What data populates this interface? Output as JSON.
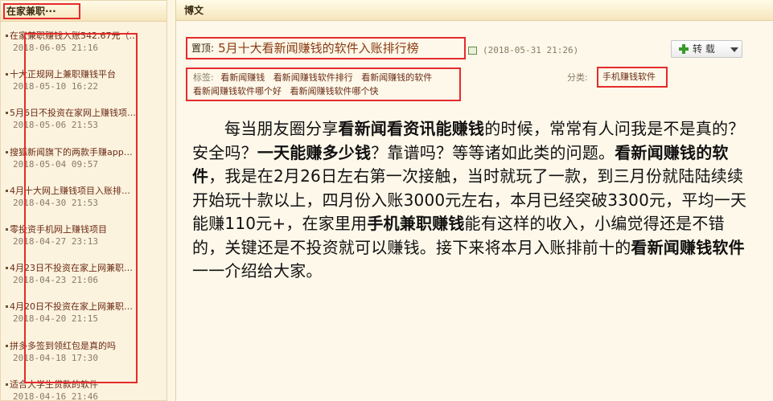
{
  "sidebar": {
    "title": "在家兼职···",
    "items": [
      {
        "title": "在家兼职赚钱入账542.67元（…",
        "date": "2018-06-05 21:16"
      },
      {
        "title": "十大正规网上兼职赚钱平台",
        "date": "2018-05-10 16:22"
      },
      {
        "title": "5月6日不投资在家网上赚钱项…",
        "date": "2018-05-06 21:53"
      },
      {
        "title": "搜狐新闻旗下的两款手赚app…",
        "date": "2018-05-04 09:57"
      },
      {
        "title": "4月十大网上赚钱项目入账排…",
        "date": "2018-04-30 21:53"
      },
      {
        "title": "零投资手机网上赚钱项目",
        "date": "2018-04-27 23:13"
      },
      {
        "title": "4月23日不投资在家上网兼职…",
        "date": "2018-04-23 21:06"
      },
      {
        "title": "4月20日不投资在家上网兼职…",
        "date": "2018-04-20 21:15"
      },
      {
        "title": "拼多多签到领红包是真的吗",
        "date": "2018-04-18 17:30"
      },
      {
        "title": "适合大学生贷款的软件",
        "date": "2018-04-16 21:46"
      }
    ]
  },
  "main": {
    "header": "博文",
    "post": {
      "pin_label": "置顶:",
      "title": "5月十大看新闻赚钱的软件入账排行榜",
      "date": "(2018-05-31 21:26)",
      "repost_label": "转 载"
    },
    "tags_label": "标签:",
    "tags": [
      "看新闻赚钱",
      "看新闻赚钱软件排行",
      "看新闻赚钱的软件",
      "看新闻赚钱软件哪个好",
      "看新闻赚钱软件哪个快"
    ],
    "category_label": "分类:",
    "category": "手机赚钱软件",
    "article": {
      "s1": "每当朋友圈分享",
      "b1": "看新闻看资讯能赚钱",
      "s2": "的时候，常常有人问我是不是真的？安全吗？",
      "b2": "一天能赚多少钱",
      "s3": "？靠谱吗？等等诸如此类的问题。",
      "b3": "看新闻赚钱的软件",
      "s4": "，我是在2月26日左右第一次接触，当时就玩了一款，到三月份就陆陆续续开始玩十款以上，四月份入账3000元左右，本月已经突破3300元，平均一天能赚110元+，在家里用",
      "b4": "手机兼职赚钱",
      "s5": "能有这样的收入，小编觉得还是不错的，关键还是不投资就可以赚钱。接下来将本月入账排前十的",
      "b5": "看新闻赚钱软件",
      "s6": "一一介绍给大家。"
    }
  },
  "colors": {
    "highlight_border": "#e52b2b",
    "link": "#6b2b14",
    "background": "#fdf6e3"
  }
}
